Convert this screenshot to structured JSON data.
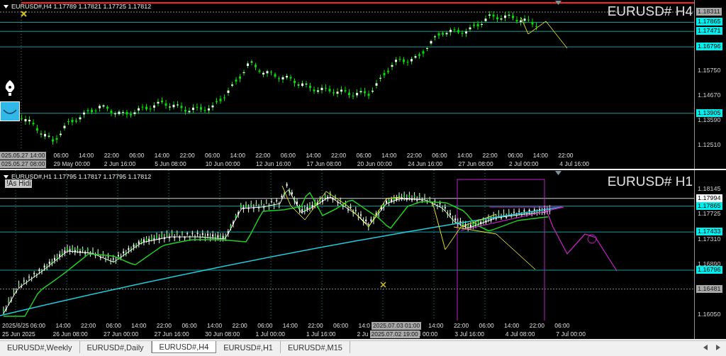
{
  "charts": [
    {
      "info": "EURUSD#,H4 1.17789 1.17821 1.17725 1.17812",
      "title": "EURUSD# H4",
      "price_labels": [
        {
          "text": "1.18311",
          "kind": "marker"
        },
        {
          "text": "1.17865",
          "kind": "level"
        },
        {
          "text": "1.17471",
          "kind": "level"
        },
        {
          "text": "1.16796",
          "kind": "level"
        },
        {
          "text": "1.15750",
          "kind": "tick"
        },
        {
          "text": "1.14670",
          "kind": "tick"
        },
        {
          "text": "1.13905",
          "kind": "level"
        },
        {
          "text": "1.13590",
          "kind": "tick"
        },
        {
          "text": "1.12510",
          "kind": "tick"
        }
      ],
      "time_rows": [
        [
          {
            "text": "025.05.27 14:00",
            "kind": "cursor"
          },
          {
            "text": "06:00",
            "kind": "tick"
          },
          {
            "text": "14:00",
            "kind": "tick"
          },
          {
            "text": "22:00",
            "kind": "tick"
          },
          {
            "text": "06:00",
            "kind": "tick"
          },
          {
            "text": "14:00",
            "kind": "tick"
          },
          {
            "text": "22:00",
            "kind": "tick"
          },
          {
            "text": "06:00",
            "kind": "tick"
          },
          {
            "text": "14:00",
            "kind": "tick"
          },
          {
            "text": "22:00",
            "kind": "tick"
          },
          {
            "text": "06:00",
            "kind": "tick"
          },
          {
            "text": "14:00",
            "kind": "tick"
          },
          {
            "text": "22:00",
            "kind": "tick"
          },
          {
            "text": "06:00",
            "kind": "tick"
          },
          {
            "text": "14:00",
            "kind": "tick"
          },
          {
            "text": "22:00",
            "kind": "tick"
          },
          {
            "text": "06:00",
            "kind": "tick"
          },
          {
            "text": "14:00",
            "kind": "tick"
          },
          {
            "text": "22:00",
            "kind": "tick"
          },
          {
            "text": "06:00",
            "kind": "tick"
          },
          {
            "text": "14:00",
            "kind": "tick"
          },
          {
            "text": "22:00",
            "kind": "tick"
          }
        ],
        [
          {
            "text": "025.05.27 08:00",
            "kind": "cursor"
          },
          {
            "text": "29 May 00:00",
            "kind": "tick"
          },
          {
            "text": "2 Jun 16:00",
            "kind": "tick"
          },
          {
            "text": "5 Jun 08:00",
            "kind": "tick"
          },
          {
            "text": "10 Jun 00:00",
            "kind": "tick"
          },
          {
            "text": "12 Jun 16:00",
            "kind": "tick"
          },
          {
            "text": "17 Jun 08:00",
            "kind": "tick"
          },
          {
            "text": "20 Jun 00:00",
            "kind": "tick"
          },
          {
            "text": "24 Jun 16:00",
            "kind": "tick"
          },
          {
            "text": "27 Jun 08:00",
            "kind": "tick"
          },
          {
            "text": "2 Jul 00:00",
            "kind": "tick"
          },
          {
            "text": "4 Jul 16:00",
            "kind": "tick"
          }
        ]
      ]
    },
    {
      "info": "EURUSD#,H1 1.17795 1.17817 1.17795 1.17812",
      "title": "EURUSD# H1",
      "button": "!As Hidi",
      "price_labels": [
        {
          "text": "1.18145",
          "kind": "tick"
        },
        {
          "text": "1.17994",
          "kind": "current"
        },
        {
          "text": "1.17865",
          "kind": "level"
        },
        {
          "text": "1.17725",
          "kind": "tick"
        },
        {
          "text": "1.17433",
          "kind": "level"
        },
        {
          "text": "1.17310",
          "kind": "tick"
        },
        {
          "text": "1.16890",
          "kind": "tick"
        },
        {
          "text": "1.16796",
          "kind": "level"
        },
        {
          "text": "1.16481",
          "kind": "marker"
        },
        {
          "text": "1.16050",
          "kind": "tick"
        }
      ],
      "time_rows": [
        [
          {
            "text": "2025/6/25",
            "kind": "cut"
          },
          {
            "text": "06:00",
            "kind": "tick"
          },
          {
            "text": "14:00",
            "kind": "tick"
          },
          {
            "text": "22:00",
            "kind": "tick"
          },
          {
            "text": "06:00",
            "kind": "tick"
          },
          {
            "text": "14:00",
            "kind": "tick"
          },
          {
            "text": "22:00",
            "kind": "tick"
          },
          {
            "text": "06:00",
            "kind": "tick"
          },
          {
            "text": "14:00",
            "kind": "tick"
          },
          {
            "text": "22:00",
            "kind": "tick"
          },
          {
            "text": "06:00",
            "kind": "tick"
          },
          {
            "text": "14:00",
            "kind": "tick"
          },
          {
            "text": "22:00",
            "kind": "tick"
          },
          {
            "text": "06:00",
            "kind": "tick"
          },
          {
            "text": "14:0",
            "kind": "cut"
          },
          {
            "text": "2025.07.03 01:00",
            "kind": "cursor"
          },
          {
            "text": "14:00",
            "kind": "tick"
          },
          {
            "text": "22:00",
            "kind": "tick"
          },
          {
            "text": "06:00",
            "kind": "tick"
          },
          {
            "text": "14:00",
            "kind": "tick"
          },
          {
            "text": "22:00",
            "kind": "tick"
          },
          {
            "text": "06:00",
            "kind": "tick"
          }
        ],
        [
          {
            "text": "25 Jun 2025",
            "kind": "tick"
          },
          {
            "text": "26 Jun 08:00",
            "kind": "tick"
          },
          {
            "text": "27 Jun 00:00",
            "kind": "tick"
          },
          {
            "text": "27 Jun 16:00",
            "kind": "tick"
          },
          {
            "text": "30 Jun 08:00",
            "kind": "tick"
          },
          {
            "text": "1 Jul 00:00",
            "kind": "tick"
          },
          {
            "text": "1 Jul 16:00",
            "kind": "tick"
          },
          {
            "text": "2 Ju",
            "kind": "cut"
          },
          {
            "text": "2025.07.02 19:00",
            "kind": "cursor"
          },
          {
            "text": "l 00:00",
            "kind": "cut"
          },
          {
            "text": "3 Jul 16:00",
            "kind": "tick"
          },
          {
            "text": "4 Jul 08:00",
            "kind": "tick"
          },
          {
            "text": "7 Jul 00:00",
            "kind": "tick"
          }
        ]
      ]
    }
  ],
  "tabs": [
    {
      "label": "EURUSD#,Weekly",
      "selected": false
    },
    {
      "label": "EURUSD#,Daily",
      "selected": false
    },
    {
      "label": "EURUSD#,H4",
      "selected": true
    },
    {
      "label": "EURUSD#,H1",
      "selected": false
    },
    {
      "label": "EURUSD#,M15",
      "selected": false
    }
  ]
}
